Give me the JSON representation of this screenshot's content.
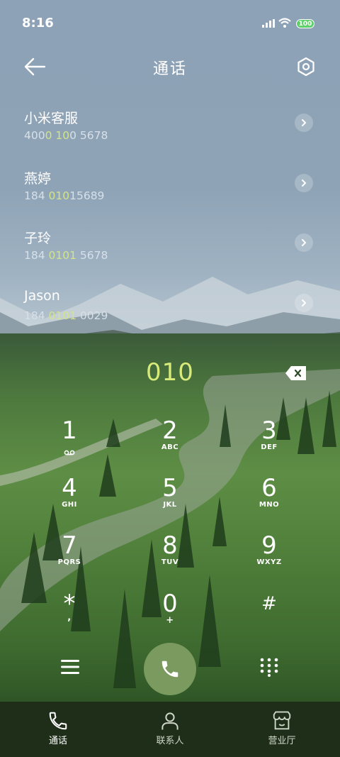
{
  "status_bar": {
    "time": "8:16",
    "battery": "100"
  },
  "header": {
    "title": "通话"
  },
  "contacts": [
    {
      "name": "小米客服",
      "number_parts": [
        "400",
        "0",
        " ",
        "10",
        "0 5678"
      ]
    },
    {
      "name": "燕婷",
      "number_parts": [
        "184 ",
        "010",
        "",
        "",
        "15689"
      ]
    },
    {
      "name": "子玲",
      "number_parts": [
        "184 ",
        "0101",
        "",
        "",
        " 5678"
      ]
    },
    {
      "name": "Jason",
      "number_parts": [
        "184 ",
        "0101",
        "",
        "",
        " 0029"
      ]
    }
  ],
  "dialer": {
    "input": "010",
    "keys": [
      {
        "digit": "1",
        "letters": ""
      },
      {
        "digit": "2",
        "letters": "ABC"
      },
      {
        "digit": "3",
        "letters": "DEF"
      },
      {
        "digit": "4",
        "letters": "GHI"
      },
      {
        "digit": "5",
        "letters": "JKL"
      },
      {
        "digit": "6",
        "letters": "MNO"
      },
      {
        "digit": "7",
        "letters": "PQRS"
      },
      {
        "digit": "8",
        "letters": "TUV"
      },
      {
        "digit": "9",
        "letters": "WXYZ"
      },
      {
        "digit": "*",
        "letters": ","
      },
      {
        "digit": "0",
        "letters": "+"
      },
      {
        "digit": "#",
        "letters": ""
      }
    ]
  },
  "bottom_nav": [
    {
      "label": "通话",
      "icon": "phone-icon",
      "active": true
    },
    {
      "label": "联系人",
      "icon": "person-icon",
      "active": false
    },
    {
      "label": "营业厅",
      "icon": "store-icon",
      "active": false
    }
  ],
  "colors": {
    "highlight": "#d4e48a",
    "dial_text": "#d8ea7a",
    "call_button": "#7b9a60",
    "nav_bg": "#1f2e18"
  }
}
